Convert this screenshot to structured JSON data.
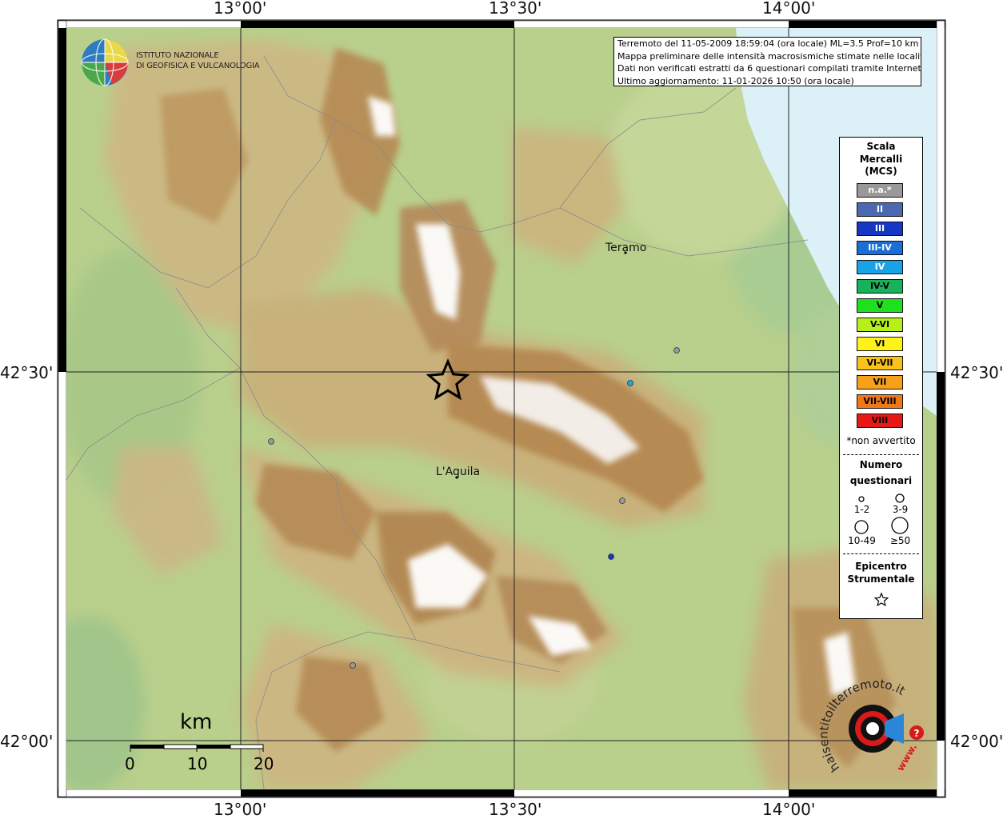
{
  "header": {
    "coords_top": [
      "13°00'",
      "13°30'",
      "14°00'"
    ],
    "coords_bottom": [
      "13°00'",
      "13°30'",
      "14°00'"
    ],
    "coords_left": [
      "42°30'",
      "42°00'"
    ],
    "coords_right": [
      "42°30'",
      "42°00'"
    ]
  },
  "logo": {
    "line1": "ISTITUTO NAZIONALE",
    "line2": "DI GEOFISICA E VULCANOLOGIA"
  },
  "info": {
    "line1": "Terremoto del 11-05-2009 18:59:04 (ora locale) ML=3.5 Prof=10 km",
    "line2": "Mappa preliminare delle intensità macrosismiche stimate nelle località",
    "line3": "Dati non verificati estratti da 6 questionari compilati tramite Internet.",
    "line4": "Ultimo aggiornamento: 11-01-2026 10:50 (ora locale)"
  },
  "cities": {
    "teramo": "Teramo",
    "laquila": "L'Aquila"
  },
  "legend": {
    "title1": "Scala",
    "title2": "Mercalli",
    "title3": "(MCS)",
    "classes": [
      {
        "label": "n.a.*",
        "color": "#999999",
        "text_color": "#ffffff"
      },
      {
        "label": "II",
        "color": "#4a69b0",
        "text_color": "#ffffff"
      },
      {
        "label": "III",
        "color": "#1537c4",
        "text_color": "#ffffff"
      },
      {
        "label": "III-IV",
        "color": "#1a6fd6",
        "text_color": "#ffffff"
      },
      {
        "label": "IV",
        "color": "#19a3e6",
        "text_color": "#ffffff"
      },
      {
        "label": "IV-V",
        "color": "#17b35a",
        "text_color": "#000000"
      },
      {
        "label": "V",
        "color": "#1ee01e",
        "text_color": "#000000"
      },
      {
        "label": "V-VI",
        "color": "#b5f01a",
        "text_color": "#000000"
      },
      {
        "label": "VI",
        "color": "#fff21a",
        "text_color": "#000000"
      },
      {
        "label": "VI-VII",
        "color": "#f8c21a",
        "text_color": "#000000"
      },
      {
        "label": "VII",
        "color": "#f8a01a",
        "text_color": "#000000"
      },
      {
        "label": "VII-VIII",
        "color": "#f07818",
        "text_color": "#000000"
      },
      {
        "label": "VIII",
        "color": "#e81818",
        "text_color": "#000000"
      }
    ],
    "not_felt": "*non avvertito",
    "count_title1": "Numero",
    "count_title2": "questionari",
    "count_labels": [
      "1-2",
      "3-9",
      "10-49",
      "≥50"
    ],
    "epi_title1": "Epicentro",
    "epi_title2": "Strumentale"
  },
  "scale": {
    "unit": "km",
    "ticks": [
      "0",
      "10",
      "20"
    ]
  },
  "points": [
    {
      "intensity": "IV",
      "color": "#19a3e6"
    },
    {
      "intensity": "III",
      "color": "#1537c4"
    },
    {
      "intensity": "n.a.*",
      "color": "#999999"
    },
    {
      "intensity": "n.a.*",
      "color": "#999999"
    },
    {
      "intensity": "n.a.*",
      "color": "#999999"
    },
    {
      "intensity": "n.a.*",
      "color": "#999999"
    }
  ],
  "watermark": {
    "text": "haisentitoilterremoto.it",
    "url": "www."
  },
  "colors": {
    "sea": "#dcf0f8",
    "lowland": "#b9cf8c",
    "hills": "#cdb884",
    "mountains": "#b58a52",
    "peaks": "#ffffff"
  }
}
